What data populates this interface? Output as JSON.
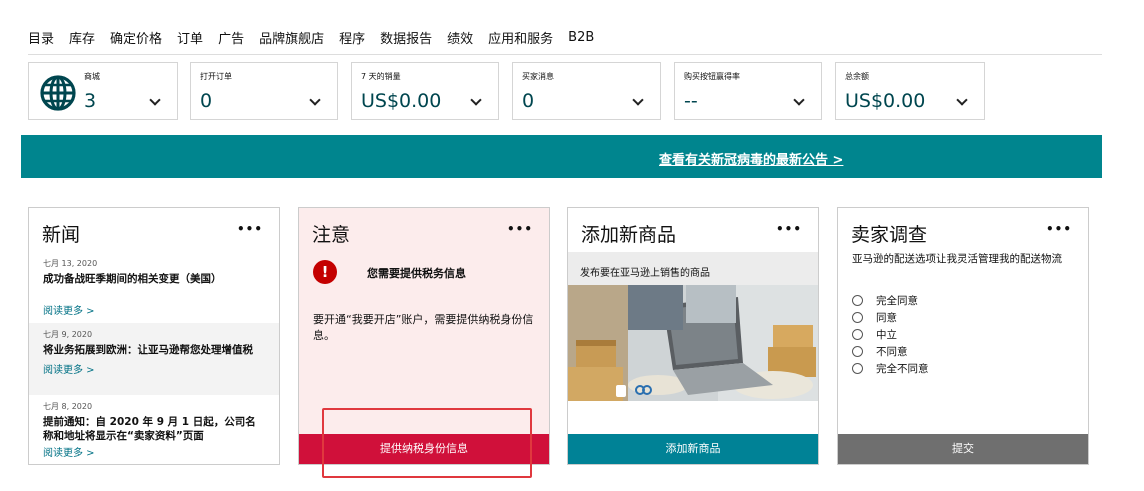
{
  "nav": {
    "items": [
      "目录",
      "库存",
      "确定价格",
      "订单",
      "广告",
      "品牌旗舰店",
      "程序",
      "数据报告",
      "绩效",
      "应用和服务",
      "B2B"
    ]
  },
  "metrics": [
    {
      "label": "商城",
      "value": "3",
      "icon": "globe-icon"
    },
    {
      "label": "打开订单",
      "value": "0"
    },
    {
      "label": "7 天的销量",
      "value": "US$0.00"
    },
    {
      "label": "买家消息",
      "value": "0"
    },
    {
      "label": "购买按钮赢得率",
      "value": "--"
    },
    {
      "label": "总余额",
      "value": "US$0.00"
    }
  ],
  "banner": {
    "text": "查看有关新冠病毒的最新公告 >",
    "color": "#00858e"
  },
  "news": {
    "title": "新闻",
    "more": "•••",
    "items": [
      {
        "date": "七月 13, 2020",
        "headline": "成功备战旺季期间的相关变更（美国）",
        "link": "阅读更多 >"
      },
      {
        "date": "七月 9, 2020",
        "headline": "将业务拓展到欧洲：让亚马逊帮您处理增值税",
        "link": "阅读更多 >"
      },
      {
        "date": "七月 8, 2020",
        "headline": "提前通知：自 2020 年 9 月 1 日起，公司名称和地址将显示在“卖家资料”页面",
        "link": "阅读更多 >"
      }
    ]
  },
  "notice": {
    "title": "注意",
    "more": "•••",
    "alert_icon": "!",
    "alert_title": "您需要提供税务信息",
    "body": "要开通“我要开店”账户，需要提供纳税身份信息。",
    "button": "提供纳税身份信息",
    "button_color": "#d0103a"
  },
  "add_product": {
    "title": "添加新商品",
    "more": "•••",
    "subtitle": "发布要在亚马逊上销售的商品",
    "button": "添加新商品"
  },
  "survey": {
    "title": "卖家调查",
    "more": "•••",
    "question": "亚马逊的配送选项让我灵活管理我的配送物流",
    "options": [
      "完全同意",
      "同意",
      "中立",
      "不同意",
      "完全不同意"
    ],
    "button": "提交"
  }
}
